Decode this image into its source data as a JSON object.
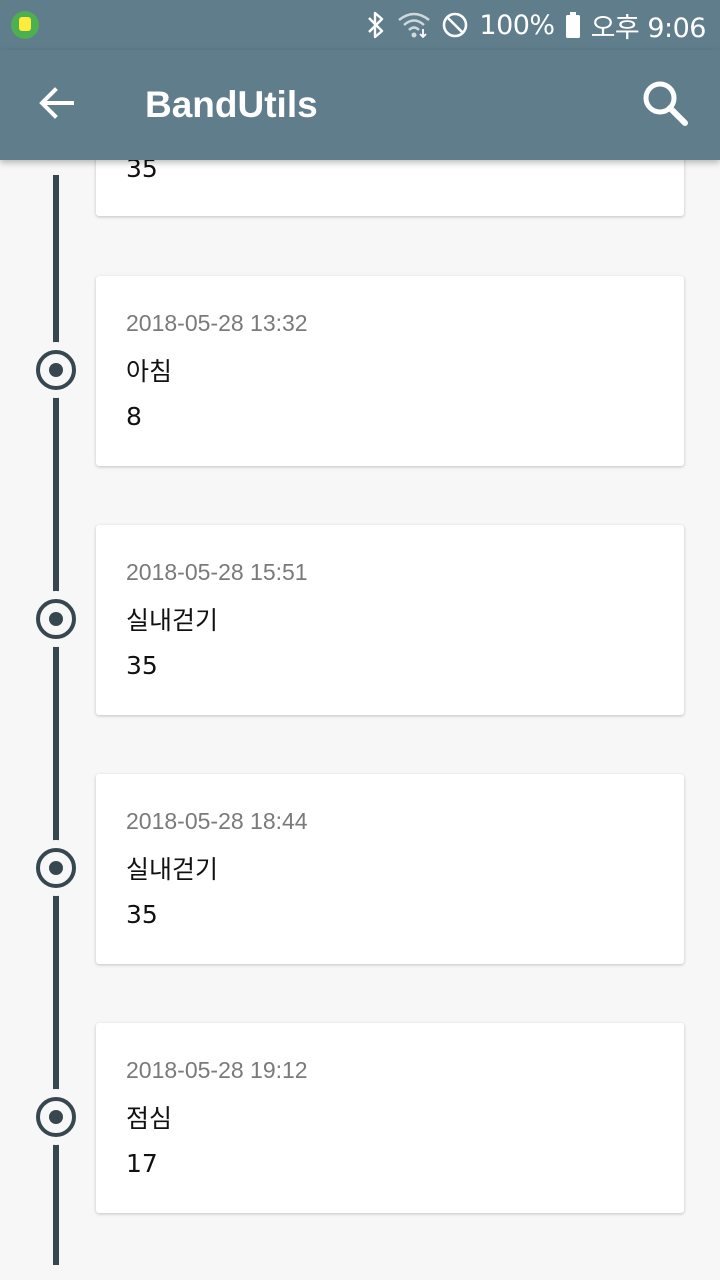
{
  "status_bar": {
    "battery_text": "100%",
    "time": "오후 9:06",
    "icons": [
      "app-notification-icon",
      "bluetooth-icon",
      "wifi-icon",
      "do-not-disturb-icon",
      "battery-icon"
    ]
  },
  "app_bar": {
    "title": "BandUtils",
    "back_icon": "arrow-back-icon",
    "search_icon": "search-icon",
    "color": "#607d8b"
  },
  "timeline": {
    "line_color": "#37474f",
    "partial_item": {
      "value": "35"
    },
    "items": [
      {
        "date": "2018-05-28 13:32",
        "title": "아침",
        "value": "8"
      },
      {
        "date": "2018-05-28 15:51",
        "title": "실내걷기",
        "value": "35"
      },
      {
        "date": "2018-05-28 18:44",
        "title": "실내걷기",
        "value": "35"
      },
      {
        "date": "2018-05-28 19:12",
        "title": "점심",
        "value": "17"
      }
    ]
  }
}
